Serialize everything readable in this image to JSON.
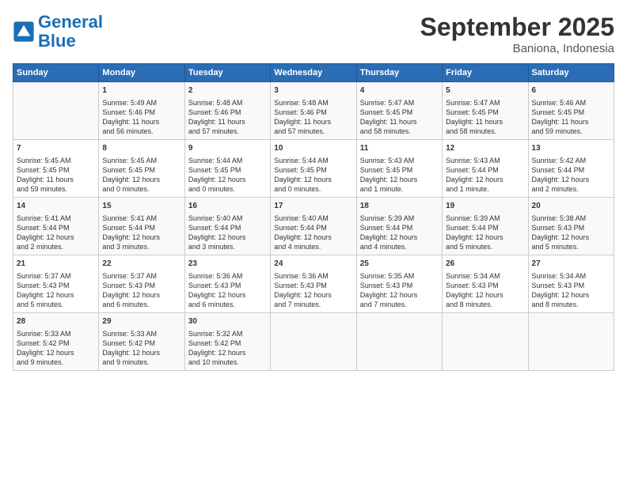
{
  "header": {
    "logo_line1": "General",
    "logo_line2": "Blue",
    "title": "September 2025",
    "subtitle": "Baniona, Indonesia"
  },
  "columns": [
    "Sunday",
    "Monday",
    "Tuesday",
    "Wednesday",
    "Thursday",
    "Friday",
    "Saturday"
  ],
  "weeks": [
    [
      {
        "day": "",
        "info": ""
      },
      {
        "day": "1",
        "info": "Sunrise: 5:49 AM\nSunset: 5:46 PM\nDaylight: 11 hours\nand 56 minutes."
      },
      {
        "day": "2",
        "info": "Sunrise: 5:48 AM\nSunset: 5:46 PM\nDaylight: 11 hours\nand 57 minutes."
      },
      {
        "day": "3",
        "info": "Sunrise: 5:48 AM\nSunset: 5:46 PM\nDaylight: 11 hours\nand 57 minutes."
      },
      {
        "day": "4",
        "info": "Sunrise: 5:47 AM\nSunset: 5:45 PM\nDaylight: 11 hours\nand 58 minutes."
      },
      {
        "day": "5",
        "info": "Sunrise: 5:47 AM\nSunset: 5:45 PM\nDaylight: 11 hours\nand 58 minutes."
      },
      {
        "day": "6",
        "info": "Sunrise: 5:46 AM\nSunset: 5:45 PM\nDaylight: 11 hours\nand 59 minutes."
      }
    ],
    [
      {
        "day": "7",
        "info": "Sunrise: 5:45 AM\nSunset: 5:45 PM\nDaylight: 11 hours\nand 59 minutes."
      },
      {
        "day": "8",
        "info": "Sunrise: 5:45 AM\nSunset: 5:45 PM\nDaylight: 12 hours\nand 0 minutes."
      },
      {
        "day": "9",
        "info": "Sunrise: 5:44 AM\nSunset: 5:45 PM\nDaylight: 12 hours\nand 0 minutes."
      },
      {
        "day": "10",
        "info": "Sunrise: 5:44 AM\nSunset: 5:45 PM\nDaylight: 12 hours\nand 0 minutes."
      },
      {
        "day": "11",
        "info": "Sunrise: 5:43 AM\nSunset: 5:45 PM\nDaylight: 12 hours\nand 1 minute."
      },
      {
        "day": "12",
        "info": "Sunrise: 5:43 AM\nSunset: 5:44 PM\nDaylight: 12 hours\nand 1 minute."
      },
      {
        "day": "13",
        "info": "Sunrise: 5:42 AM\nSunset: 5:44 PM\nDaylight: 12 hours\nand 2 minutes."
      }
    ],
    [
      {
        "day": "14",
        "info": "Sunrise: 5:41 AM\nSunset: 5:44 PM\nDaylight: 12 hours\nand 2 minutes."
      },
      {
        "day": "15",
        "info": "Sunrise: 5:41 AM\nSunset: 5:44 PM\nDaylight: 12 hours\nand 3 minutes."
      },
      {
        "day": "16",
        "info": "Sunrise: 5:40 AM\nSunset: 5:44 PM\nDaylight: 12 hours\nand 3 minutes."
      },
      {
        "day": "17",
        "info": "Sunrise: 5:40 AM\nSunset: 5:44 PM\nDaylight: 12 hours\nand 4 minutes."
      },
      {
        "day": "18",
        "info": "Sunrise: 5:39 AM\nSunset: 5:44 PM\nDaylight: 12 hours\nand 4 minutes."
      },
      {
        "day": "19",
        "info": "Sunrise: 5:39 AM\nSunset: 5:44 PM\nDaylight: 12 hours\nand 5 minutes."
      },
      {
        "day": "20",
        "info": "Sunrise: 5:38 AM\nSunset: 5:43 PM\nDaylight: 12 hours\nand 5 minutes."
      }
    ],
    [
      {
        "day": "21",
        "info": "Sunrise: 5:37 AM\nSunset: 5:43 PM\nDaylight: 12 hours\nand 5 minutes."
      },
      {
        "day": "22",
        "info": "Sunrise: 5:37 AM\nSunset: 5:43 PM\nDaylight: 12 hours\nand 6 minutes."
      },
      {
        "day": "23",
        "info": "Sunrise: 5:36 AM\nSunset: 5:43 PM\nDaylight: 12 hours\nand 6 minutes."
      },
      {
        "day": "24",
        "info": "Sunrise: 5:36 AM\nSunset: 5:43 PM\nDaylight: 12 hours\nand 7 minutes."
      },
      {
        "day": "25",
        "info": "Sunrise: 5:35 AM\nSunset: 5:43 PM\nDaylight: 12 hours\nand 7 minutes."
      },
      {
        "day": "26",
        "info": "Sunrise: 5:34 AM\nSunset: 5:43 PM\nDaylight: 12 hours\nand 8 minutes."
      },
      {
        "day": "27",
        "info": "Sunrise: 5:34 AM\nSunset: 5:43 PM\nDaylight: 12 hours\nand 8 minutes."
      }
    ],
    [
      {
        "day": "28",
        "info": "Sunrise: 5:33 AM\nSunset: 5:42 PM\nDaylight: 12 hours\nand 9 minutes."
      },
      {
        "day": "29",
        "info": "Sunrise: 5:33 AM\nSunset: 5:42 PM\nDaylight: 12 hours\nand 9 minutes."
      },
      {
        "day": "30",
        "info": "Sunrise: 5:32 AM\nSunset: 5:42 PM\nDaylight: 12 hours\nand 10 minutes."
      },
      {
        "day": "",
        "info": ""
      },
      {
        "day": "",
        "info": ""
      },
      {
        "day": "",
        "info": ""
      },
      {
        "day": "",
        "info": ""
      }
    ]
  ]
}
